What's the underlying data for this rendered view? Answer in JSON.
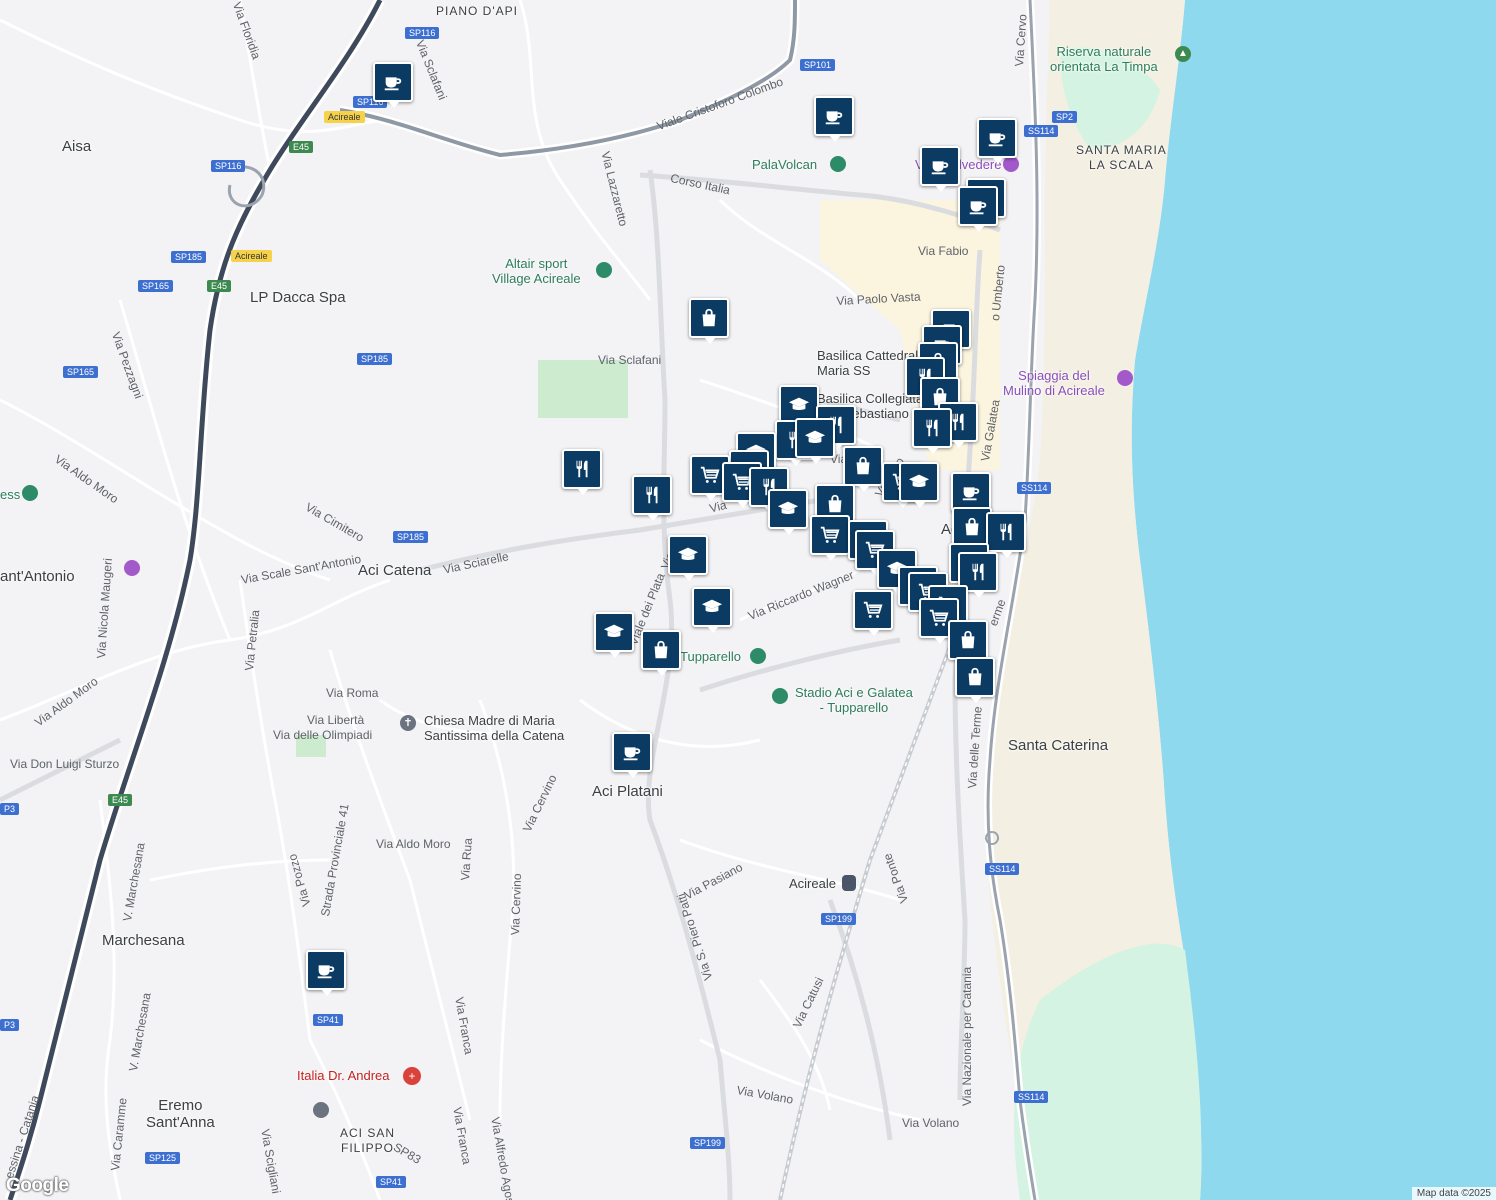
{
  "map": {
    "attribution": "Map data ©2025",
    "logo": "Google",
    "places": [
      {
        "id": "place-piano-dapi",
        "name": "PIANO D'API",
        "small": true
      },
      {
        "id": "place-aisa",
        "name": "Aisa"
      },
      {
        "id": "place-santa-maria",
        "name": "SANTA MARIA\nLA SCALA",
        "small": true
      },
      {
        "id": "place-lp-dacca",
        "name": "LP Dacca Spa"
      },
      {
        "id": "place-aci-catena",
        "name": "Aci Catena"
      },
      {
        "id": "place-santantonio",
        "name": "ant'Antonio"
      },
      {
        "id": "place-aci-platani",
        "name": "Aci Platani"
      },
      {
        "id": "place-santa-caterina",
        "name": "Santa Caterina"
      },
      {
        "id": "place-marchesana",
        "name": "Marchesana"
      },
      {
        "id": "place-eremo",
        "name": "Eremo\nSant'Anna"
      },
      {
        "id": "place-aci-san-filippo",
        "name": "ACI SAN\nFILIPPO",
        "small": true
      },
      {
        "id": "place-aci-partial",
        "name": "Ac"
      }
    ],
    "pois": [
      {
        "id": "poi-riserva",
        "name": "Riserva naturale\norientata La Timpa",
        "color": "green",
        "icon": "tree-icon"
      },
      {
        "id": "poi-palavolcan",
        "name": "PalaVolcan",
        "color": "green",
        "icon": "pin-icon"
      },
      {
        "id": "poi-villa",
        "name": "Villa Belvedere",
        "color": "purple",
        "icon": "camera-icon"
      },
      {
        "id": "poi-altair",
        "name": "Altair sport\nVillage Acireale",
        "color": "green",
        "icon": "pin-icon"
      },
      {
        "id": "poi-basilica-cattedrale",
        "name": "Basilica Cattedrale\nMaria SS",
        "color": "gray",
        "icon": "none"
      },
      {
        "id": "poi-basilica-collegiata",
        "name": "Basilica Collegiata\nSan Sebastiano",
        "color": "gray",
        "icon": "none"
      },
      {
        "id": "poi-spiaggia",
        "name": "Spiaggia del\nMulino di Acireale",
        "color": "purple",
        "icon": "camera-icon"
      },
      {
        "id": "poi-tupparello",
        "name": "Tupparello",
        "color": "green",
        "icon": "pin-icon"
      },
      {
        "id": "poi-stadio",
        "name": "Stadio Aci e Galatea\n- Tupparello",
        "color": "green",
        "icon": "stadium-icon"
      },
      {
        "id": "poi-chiesa",
        "name": "Chiesa Madre di Maria\nSantissima della Catena",
        "color": "gray",
        "icon": "church-icon"
      },
      {
        "id": "poi-acireale-station",
        "name": "Acireale",
        "color": "gray",
        "icon": "train-icon"
      },
      {
        "id": "poi-italia-andrea",
        "name": "Italia Dr. Andrea",
        "color": "red",
        "icon": "hospital-icon"
      },
      {
        "id": "poi-ess",
        "name": "ess",
        "color": "green",
        "icon": "pin-icon"
      }
    ],
    "streets": [
      {
        "id": "st-floridia",
        "name": "Via Floridia"
      },
      {
        "id": "st-sclafani-top",
        "name": "Via Sclafani"
      },
      {
        "id": "st-cristoforo",
        "name": "Viale Cristoforo Colombo"
      },
      {
        "id": "st-lazzaretto",
        "name": "Via Lazzaretto"
      },
      {
        "id": "st-corso-italia",
        "name": "Corso Italia"
      },
      {
        "id": "st-cervo",
        "name": "Via Cervo"
      },
      {
        "id": "st-fabio",
        "name": "Via Fabio"
      },
      {
        "id": "st-umberto",
        "name": "o Umberto"
      },
      {
        "id": "st-paolo-vasta",
        "name": "Via Paolo Vasta"
      },
      {
        "id": "st-sclafani",
        "name": "Via Sclafani"
      },
      {
        "id": "st-pezzagni",
        "name": "Via Pezzagni"
      },
      {
        "id": "st-aldo-moro-w",
        "name": "Via Aldo Moro"
      },
      {
        "id": "st-galatea",
        "name": "Via Galatea"
      },
      {
        "id": "st-cimitero",
        "name": "Via Cimitero"
      },
      {
        "id": "st-sciarelle",
        "name": "Via Sciarelle"
      },
      {
        "id": "st-scale",
        "name": "Via Scale Sant'Antonio"
      },
      {
        "id": "st-platani",
        "name": "Viale dei Plata"
      },
      {
        "id": "st-wagner",
        "name": "Via Riccardo Wagner"
      },
      {
        "id": "st-maugeri",
        "name": "Via Nicola Maugeri"
      },
      {
        "id": "st-petralia",
        "name": "Via Petralia"
      },
      {
        "id": "st-roma",
        "name": "Via Roma"
      },
      {
        "id": "st-aldo-moro-sw",
        "name": "Via Aldo Moro"
      },
      {
        "id": "st-liberta",
        "name": "Via Libertà"
      },
      {
        "id": "st-olimpiadi",
        "name": "Via delle Olimpiadi"
      },
      {
        "id": "st-sturzo",
        "name": "Via Don Luigi Sturzo"
      },
      {
        "id": "st-cervino",
        "name": "Via Cervino"
      },
      {
        "id": "st-terme",
        "name": "Via delle Terme"
      },
      {
        "id": "st-terme2",
        "name": "erme"
      },
      {
        "id": "st-sp41",
        "name": "Strada Provinciale 41"
      },
      {
        "id": "st-aldo-moro-s",
        "name": "Via Aldo Moro"
      },
      {
        "id": "st-rua",
        "name": "Via Rua"
      },
      {
        "id": "st-pasiano",
        "name": "Via Pasiano"
      },
      {
        "id": "st-piero-patti",
        "name": "Via S. Piero Patti"
      },
      {
        "id": "st-ponte",
        "name": "Via Ponte"
      },
      {
        "id": "st-pozzo",
        "name": "Via Pozzo"
      },
      {
        "id": "st-marchesana",
        "name": "V. Marchesana"
      },
      {
        "id": "st-cervino2",
        "name": "Via Cervino"
      },
      {
        "id": "st-nazionale",
        "name": "Via Nazionale per Catania"
      },
      {
        "id": "st-marchesana2",
        "name": "V. Marchesana"
      },
      {
        "id": "st-franca",
        "name": "Via Franca"
      },
      {
        "id": "st-catusi",
        "name": "Via Catusi"
      },
      {
        "id": "st-volano",
        "name": "Via Volano"
      },
      {
        "id": "st-volano2",
        "name": "Via Volano"
      },
      {
        "id": "st-caramme",
        "name": "Via Caramme"
      },
      {
        "id": "st-franca2",
        "name": "Via Franca"
      },
      {
        "id": "st-alfredo",
        "name": "Via Alfredo Agos"
      },
      {
        "id": "st-scigliani",
        "name": "Via Scigliani"
      },
      {
        "id": "st-catania",
        "name": "essina - Catania"
      },
      {
        "id": "st-sp83",
        "name": "SP83"
      },
      {
        "id": "st-via-b",
        "name": "Via"
      },
      {
        "id": "st-via-c",
        "name": "Via"
      },
      {
        "id": "st-via-tino",
        "name": "Via rtino"
      },
      {
        "id": "st-via-d",
        "name": "Via"
      }
    ],
    "shields": [
      {
        "id": "sh-sp116-a",
        "text": "SP116"
      },
      {
        "id": "sh-sp116-b",
        "text": "SP116"
      },
      {
        "id": "sh-sp116-c",
        "text": "SP116"
      },
      {
        "id": "sh-sp101",
        "text": "SP101"
      },
      {
        "id": "sh-acireale-a",
        "text": "Acireale",
        "color": "yellow"
      },
      {
        "id": "sh-e45-a",
        "text": "E45",
        "color": "green"
      },
      {
        "id": "sh-sp185-a",
        "text": "SP185"
      },
      {
        "id": "sh-acireale-b",
        "text": "Acireale",
        "color": "yellow"
      },
      {
        "id": "sh-sp165-a",
        "text": "SP165"
      },
      {
        "id": "sh-e45-b",
        "text": "E45",
        "color": "green"
      },
      {
        "id": "sh-sp185-b",
        "text": "SP185"
      },
      {
        "id": "sh-sp165-b",
        "text": "SP165"
      },
      {
        "id": "sh-ss114-a",
        "text": "SS114"
      },
      {
        "id": "sh-sp2",
        "text": "SP2"
      },
      {
        "id": "sh-sp185-c",
        "text": "SP185"
      },
      {
        "id": "sh-ss114-b",
        "text": "SS114"
      },
      {
        "id": "sh-e45-c",
        "text": "E45",
        "color": "green"
      },
      {
        "id": "sh-p3-a",
        "text": "P3"
      },
      {
        "id": "sh-ss114-c",
        "text": "SS114"
      },
      {
        "id": "sh-sp199-a",
        "text": "SP199"
      },
      {
        "id": "sh-p3-b",
        "text": "P3"
      },
      {
        "id": "sh-sp41-a",
        "text": "SP41"
      },
      {
        "id": "sh-ss114-d",
        "text": "SS114"
      },
      {
        "id": "sh-sp199-b",
        "text": "SP199"
      },
      {
        "id": "sh-sp125",
        "text": "SP125"
      },
      {
        "id": "sh-sp41-b",
        "text": "SP41"
      }
    ],
    "marker_icons": {
      "cafe": "coffee-cup-icon",
      "shop": "shopping-bag-icon",
      "restaurant": "fork-knife-icon",
      "grocery": "shopping-cart-icon",
      "school": "graduation-cap-icon"
    }
  }
}
